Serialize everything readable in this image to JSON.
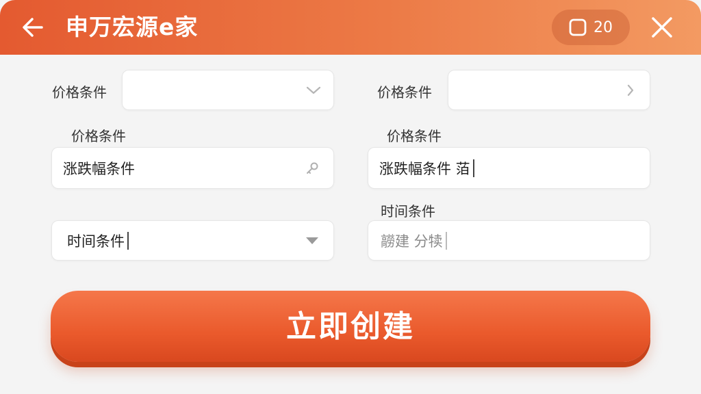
{
  "header": {
    "title": "申万宏源e家",
    "counter": "20",
    "back_icon": "arrow-left-icon",
    "close_icon": "close-icon"
  },
  "form": {
    "row1_left_label": "价格条件",
    "row1_left_value": "",
    "row1_right_label": "价格条件",
    "row1_right_value": "",
    "row2_left_label": "价格条件",
    "row2_left_value": "涨跌幅条件",
    "row2_right_label": "价格条件",
    "row2_right_value": "涨跌幅条件 萡",
    "row3_left_value": "时间条件",
    "row3_right_label": "时间条件",
    "row3_right_value": "髝建 分犊"
  },
  "submit": {
    "label": "立即创建"
  },
  "colors": {
    "accent": "#e8582b",
    "header_start": "#e45a30",
    "header_end": "#f39a62"
  }
}
